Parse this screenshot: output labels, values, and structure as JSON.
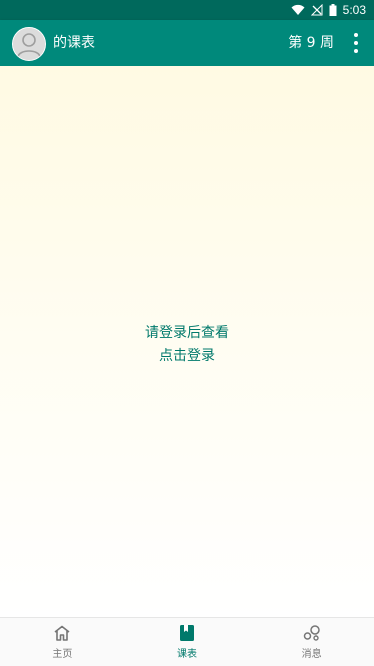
{
  "status_bar": {
    "time": "5:03"
  },
  "app_bar": {
    "title": "的课表",
    "week": "第 9 周"
  },
  "content": {
    "login_prompt": "请登录后查看",
    "login_link": "点击登录"
  },
  "bottom_nav": {
    "items": [
      {
        "label": "主页",
        "icon": "home-icon",
        "active": false
      },
      {
        "label": "课表",
        "icon": "book-icon",
        "active": true
      },
      {
        "label": "消息",
        "icon": "bubbles-icon",
        "active": false
      }
    ]
  },
  "colors": {
    "status_bar": "#00695c",
    "app_bar": "#00897b",
    "accent": "#00796b"
  }
}
